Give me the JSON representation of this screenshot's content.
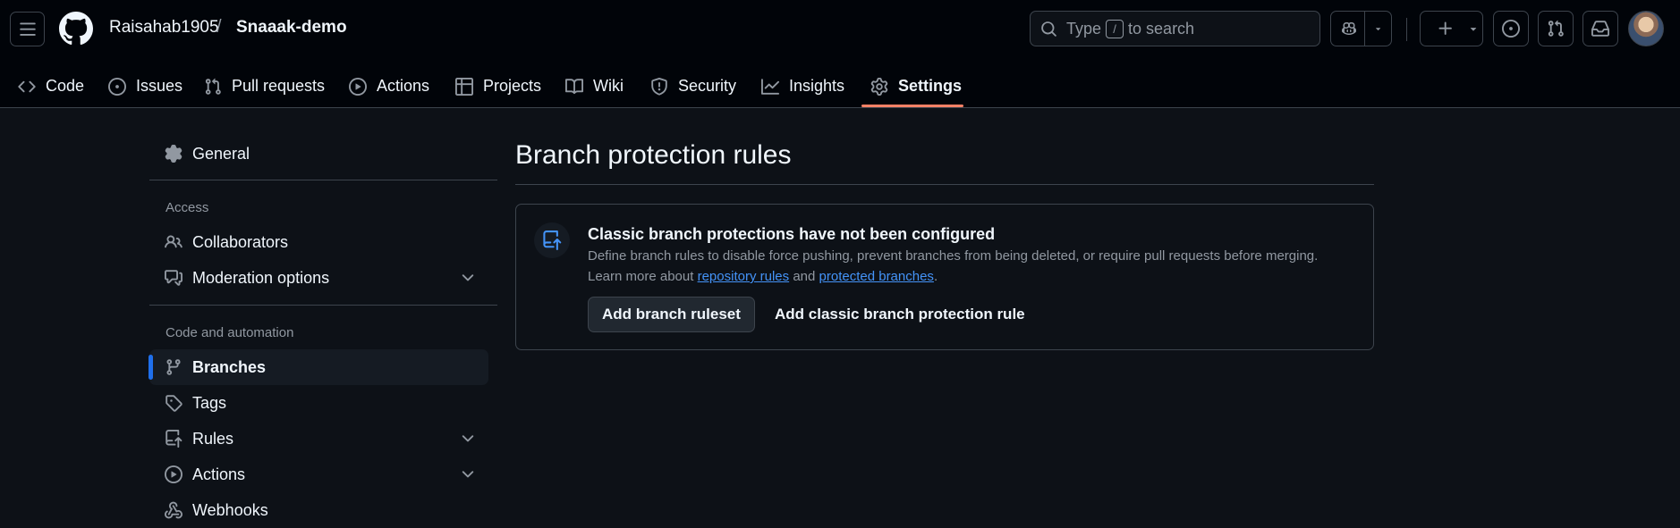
{
  "header": {
    "owner": "Raisahab1905",
    "separator": "/",
    "repo": "Snaaak-demo",
    "search": {
      "prefix": "Type",
      "key": "/",
      "suffix": "to search"
    }
  },
  "tabs": [
    {
      "label": "Code",
      "icon": "code-icon"
    },
    {
      "label": "Issues",
      "icon": "issue-opened-icon"
    },
    {
      "label": "Pull requests",
      "icon": "git-pull-request-icon"
    },
    {
      "label": "Actions",
      "icon": "play-icon"
    },
    {
      "label": "Projects",
      "icon": "table-icon"
    },
    {
      "label": "Wiki",
      "icon": "book-icon"
    },
    {
      "label": "Security",
      "icon": "shield-icon"
    },
    {
      "label": "Insights",
      "icon": "graph-icon"
    },
    {
      "label": "Settings",
      "icon": "gear-icon",
      "active": true
    }
  ],
  "sidebar": {
    "general": "General",
    "access_heading": "Access",
    "collaborators": "Collaborators",
    "moderation": "Moderation options",
    "code_heading": "Code and automation",
    "branches": "Branches",
    "tags": "Tags",
    "rules": "Rules",
    "actions": "Actions",
    "webhooks": "Webhooks"
  },
  "main": {
    "title": "Branch protection rules",
    "card": {
      "title": "Classic branch protections have not been configured",
      "description": "Define branch rules to disable force pushing, prevent branches from being deleted, or require pull requests before merging.",
      "learn_prefix": "Learn more about",
      "link_repository_rules": "repository rules",
      "learn_and": "and",
      "link_protected_branches": "protected branches",
      "learn_suffix": ".",
      "primary_button": "Add branch ruleset",
      "secondary_button": "Add classic branch protection rule"
    }
  },
  "colors": {
    "accent_underline": "#f78166",
    "link": "#4493f8",
    "selection_bar": "#1f6feb",
    "background": "#0d1117",
    "header_background": "#010409"
  }
}
